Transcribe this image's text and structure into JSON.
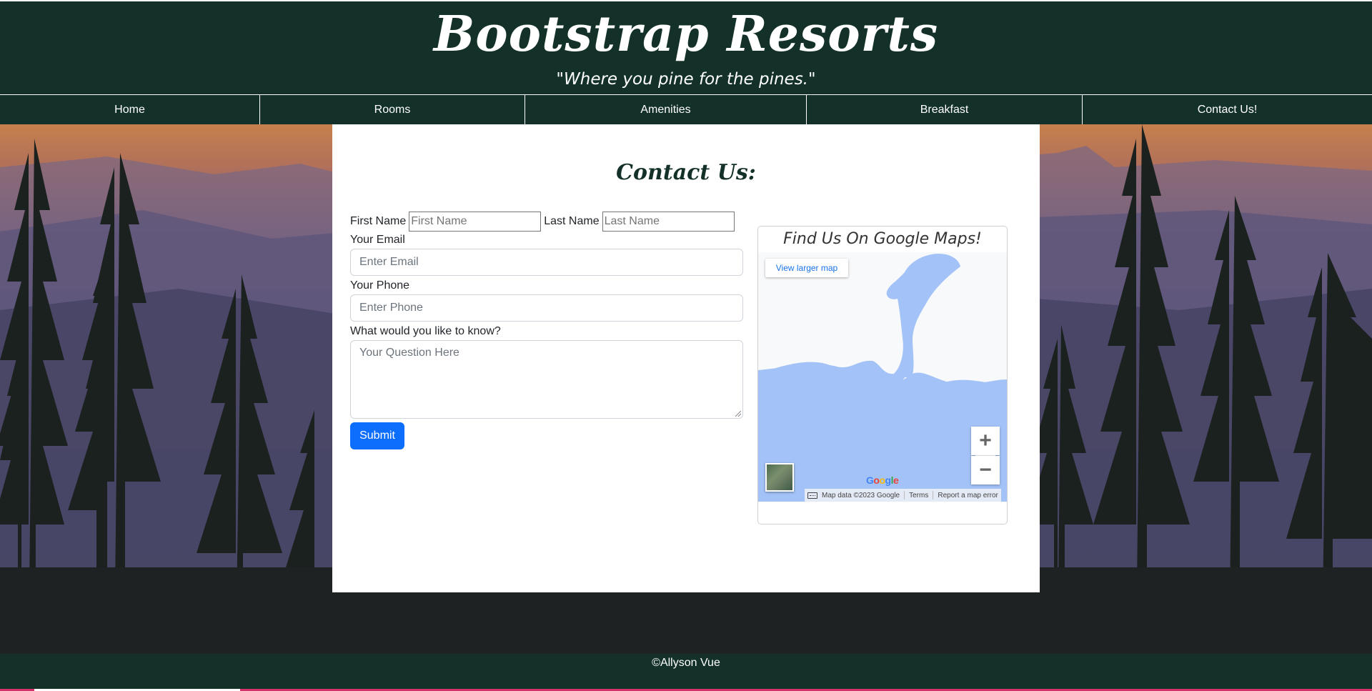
{
  "header": {
    "brand": "Bootstrap Resorts",
    "tagline": "\"Where you pine for the pines.\""
  },
  "nav": {
    "items": [
      "Home",
      "Rooms",
      "Amenities",
      "Breakfast",
      "Contact Us!"
    ]
  },
  "contact": {
    "title": "Contact Us:",
    "first_name_label": "First Name",
    "first_name_placeholder": "First Name",
    "last_name_label": "Last Name",
    "last_name_placeholder": "Last Name",
    "email_label": "Your Email",
    "email_placeholder": "Enter Email",
    "phone_label": "Your Phone",
    "phone_placeholder": "Enter Phone",
    "question_label": "What would you like to know?",
    "question_placeholder": "Your Question Here",
    "submit_label": "Submit"
  },
  "map": {
    "title": "Find Us On Google Maps!",
    "larger_map_link": "View larger map",
    "zoom_in": "+",
    "zoom_out": "−",
    "logo": "Google",
    "map_data": "Map data ©2023 Google",
    "terms": "Terms",
    "report": "Report a map error",
    "water_color": "#a3c2f7",
    "land_color": "#f8f9fa"
  },
  "footer": {
    "copyright": "©Allyson Vue"
  },
  "colors": {
    "brand_green": "#143129",
    "primary_blue": "#0d6efd"
  }
}
